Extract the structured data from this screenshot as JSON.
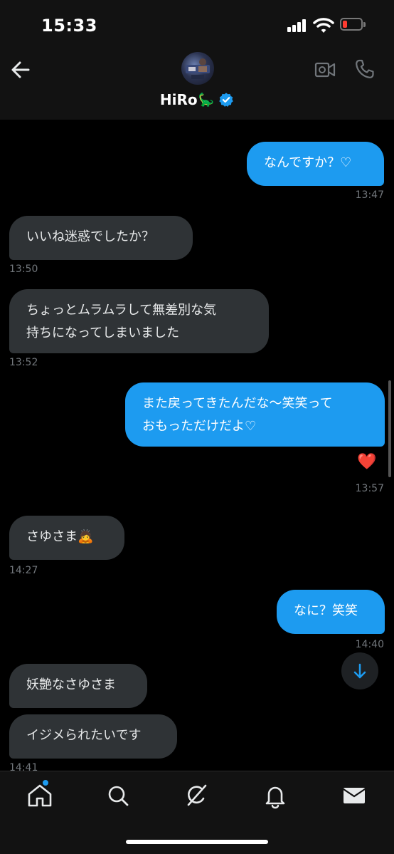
{
  "status_bar": {
    "time": "15:33"
  },
  "header": {
    "contact_name": "HiRo",
    "name_emoji": "🦕"
  },
  "messages": [
    {
      "direction": "out",
      "lines": [
        "なんですか？♡"
      ]
    },
    {
      "direction": "out",
      "time": "13:47"
    },
    {
      "direction": "in",
      "lines": [
        "いいね迷惑でしたか？"
      ],
      "time": "13:50"
    },
    {
      "direction": "in",
      "lines": [
        "ちょっとムラムラして無差別な気",
        "持ちになってしまいました"
      ],
      "time": "13:52"
    },
    {
      "direction": "out",
      "lines": [
        "また戻ってきたんだな〜笑笑って",
        "おもっただけだよ♡"
      ],
      "reaction": "❤️",
      "time": "13:57"
    },
    {
      "direction": "in",
      "lines": [
        "さゆさま🙇"
      ],
      "time": "14:27"
    },
    {
      "direction": "out",
      "lines": [
        "なに？笑笑"
      ],
      "time": "14:40"
    },
    {
      "direction": "in",
      "lines": [
        "妖艶なさゆさま"
      ]
    },
    {
      "direction": "in",
      "lines": [
        "イジメられたいです"
      ],
      "time": "14:41"
    }
  ],
  "icons": {
    "back": "arrow-left-icon",
    "video_call": "video-camera-icon",
    "phone_call": "phone-icon",
    "verified": "verified-badge-icon",
    "scroll_down": "arrow-down-icon",
    "tabs": [
      "home-icon",
      "search-icon",
      "grok-icon",
      "bell-icon",
      "mail-icon"
    ]
  },
  "colors": {
    "accent": "#1d9bf0",
    "incoming_bubble": "#2f3336",
    "battery_low": "#ff3b30"
  }
}
